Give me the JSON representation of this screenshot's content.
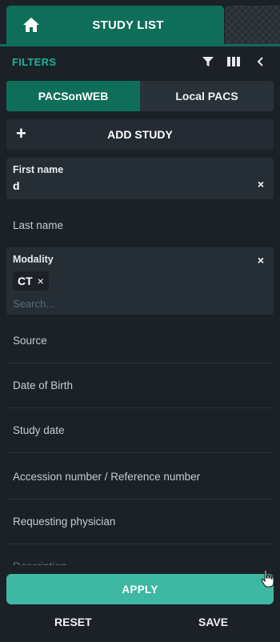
{
  "header": {
    "home_icon": "home-icon",
    "tab_title": "STUDY LIST"
  },
  "filters": {
    "label": "FILTERS",
    "icons": [
      "filter-icon",
      "columns-icon",
      "chevron-left-icon"
    ]
  },
  "source_switch": {
    "options": [
      "PACSonWEB",
      "Local PACS"
    ],
    "selected": "PACSonWEB"
  },
  "add_study": {
    "icon": "plus-icon",
    "label": "ADD STUDY"
  },
  "fields": {
    "first_name": {
      "label": "First name",
      "value": "d",
      "clear": "×"
    },
    "last_name": {
      "label": "Last name"
    },
    "modality": {
      "label": "Modality",
      "clear": "×",
      "chips": [
        {
          "label": "CT",
          "remove": "×"
        }
      ],
      "search_placeholder": "Search..."
    },
    "source": {
      "label": "Source"
    },
    "date_of_birth": {
      "label": "Date of Birth"
    },
    "study_date": {
      "label": "Study date"
    },
    "accession": {
      "label": "Accession number / Reference number"
    },
    "requesting_physician": {
      "label": "Requesting physician"
    },
    "partial_next": {
      "label": "Description"
    }
  },
  "actions": {
    "apply": "APPLY",
    "reset": "RESET",
    "save": "SAVE"
  },
  "colors": {
    "background": "#1b2127",
    "tab_active": "#0f6e5a",
    "accent_text": "#1fb19a",
    "apply_button": "#3eb7a3",
    "card": "#262e35"
  }
}
